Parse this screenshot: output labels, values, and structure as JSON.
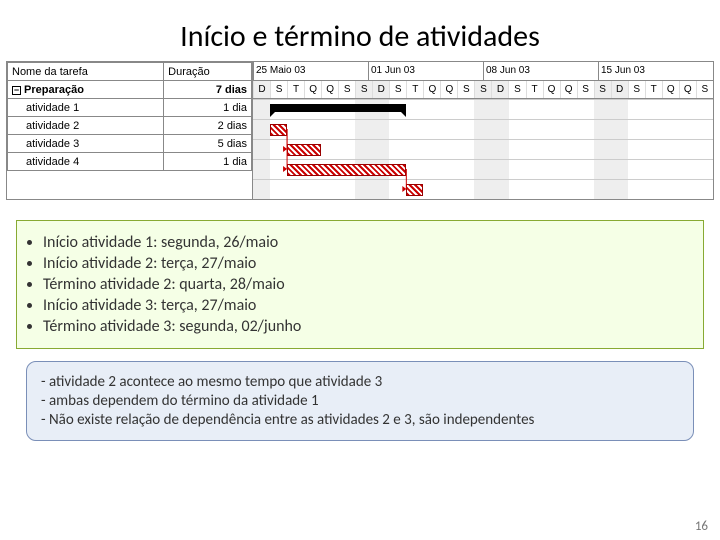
{
  "title": "Início e término de atividades",
  "table": {
    "col_task": "Nome da tarefa",
    "col_duration": "Duração",
    "rows": [
      {
        "name": "Preparação",
        "duration": "7 dias",
        "bold": true,
        "expander": "−"
      },
      {
        "name": "atividade 1",
        "duration": "1 dia"
      },
      {
        "name": "atividade 2",
        "duration": "2 dias"
      },
      {
        "name": "atividade 3",
        "duration": "5 dias"
      },
      {
        "name": "atividade 4",
        "duration": "1 dia"
      }
    ]
  },
  "timeline": {
    "weeks": [
      "25 Maio 03",
      "01 Jun 03",
      "08 Jun 03",
      "15 Jun 03"
    ],
    "days": [
      "D",
      "S",
      "T",
      "Q",
      "Q",
      "S",
      "S",
      "D",
      "S",
      "T",
      "Q",
      "Q",
      "S",
      "S",
      "D",
      "S",
      "T",
      "Q",
      "Q",
      "S",
      "S",
      "D",
      "S",
      "T",
      "Q",
      "Q",
      "S"
    ]
  },
  "bullets": [
    "Início atividade 1: segunda, 26/maio",
    "Início atividade 2: terça, 27/maio",
    "Término atividade 2: quarta, 28/maio",
    "Início atividade 3: terça, 27/maio",
    "Término atividade 3: segunda, 02/junho"
  ],
  "notes": [
    "- atividade 2 acontece ao mesmo tempo que atividade 3",
    "- ambas dependem do término da atividade 1",
    "- Não existe relação de dependência entre as atividades 2 e 3, são independentes"
  ],
  "page_num": "16",
  "chart_data": {
    "type": "gantt",
    "date_origin": "2003-05-25",
    "unit": "day",
    "weekends": [
      0,
      6,
      7,
      13,
      14,
      20,
      21,
      27
    ],
    "tasks": [
      {
        "name": "Preparação",
        "start": 1,
        "end": 9,
        "type": "summary"
      },
      {
        "name": "atividade 1",
        "start": 1,
        "end": 2,
        "type": "task"
      },
      {
        "name": "atividade 2",
        "start": 2,
        "end": 4,
        "type": "task"
      },
      {
        "name": "atividade 3",
        "start": 2,
        "end": 9,
        "type": "task"
      },
      {
        "name": "atividade 4",
        "start": 9,
        "end": 10,
        "type": "task"
      }
    ],
    "links": [
      {
        "from": 1,
        "to": 2
      },
      {
        "from": 1,
        "to": 3
      },
      {
        "from": 3,
        "to": 4
      }
    ]
  }
}
